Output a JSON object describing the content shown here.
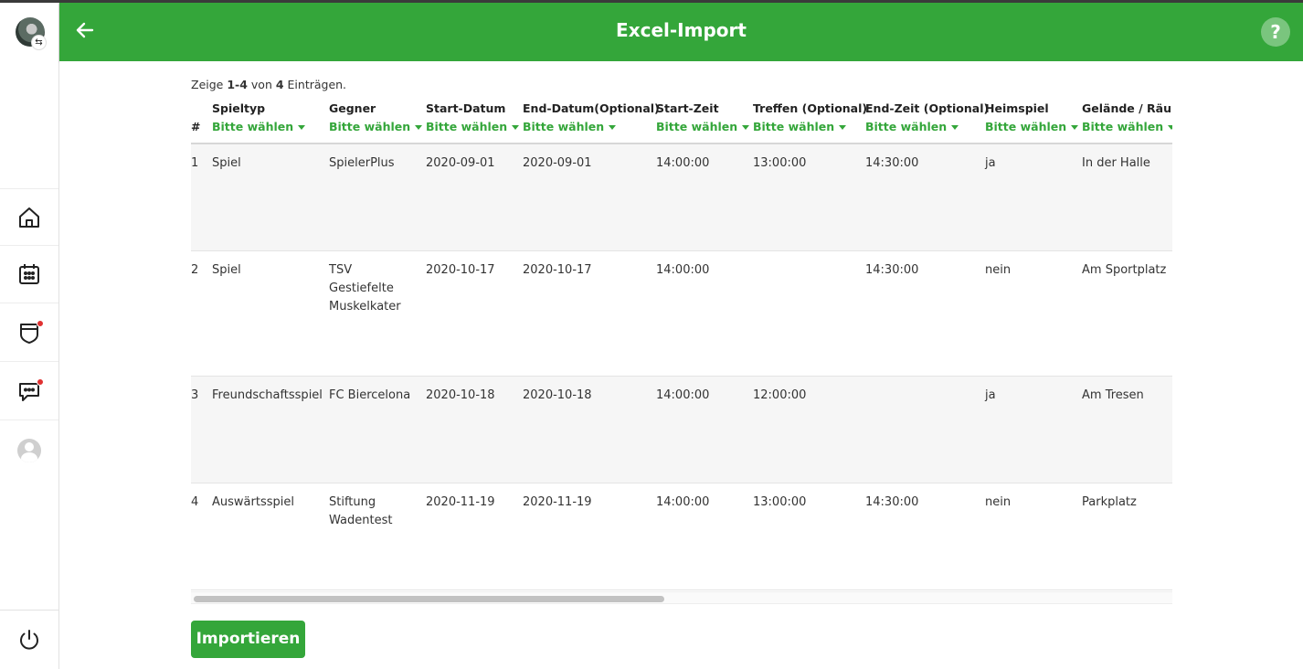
{
  "header": {
    "title": "Excel-Import",
    "help_label": "?"
  },
  "sidebar": {
    "swap_badge": "⇆",
    "items": [
      {
        "name": "home-icon"
      },
      {
        "name": "calendar-icon"
      },
      {
        "name": "shield-icon",
        "badge": true
      },
      {
        "name": "chat-icon",
        "badge": true
      },
      {
        "name": "profile-avatar"
      }
    ],
    "logout_icon": "power-icon"
  },
  "summary": {
    "prefix": "Zeige ",
    "range": "1-4",
    "middle": " von ",
    "total": "4",
    "suffix": " Einträgen."
  },
  "table": {
    "index_header": "#",
    "select_label": "Bitte wählen",
    "columns": [
      {
        "title": "Spieltyp"
      },
      {
        "title": "Gegner"
      },
      {
        "title": "Start-Datum"
      },
      {
        "title": "End-Datum(Optional)"
      },
      {
        "title": "Start-Zeit"
      },
      {
        "title": "Treffen (Optional)"
      },
      {
        "title": "End-Zeit (Optional)"
      },
      {
        "title": "Heimspiel"
      },
      {
        "title": "Gelände / Räumlichkeit"
      }
    ],
    "rows": [
      {
        "idx": "1",
        "cells": [
          "Spiel",
          "SpielerPlus",
          "2020-09-01",
          "2020-09-01",
          "14:00:00",
          "13:00:00",
          "14:30:00",
          "ja",
          "In der Halle"
        ]
      },
      {
        "idx": "2",
        "cells": [
          "Spiel",
          "TSV Gestiefelte Muskelkater",
          "2020-10-17",
          "2020-10-17",
          "14:00:00",
          "",
          "14:30:00",
          "nein",
          "Am Sportplatz"
        ]
      },
      {
        "idx": "3",
        "cells": [
          "Freundschaftsspiel",
          "FC Biercelona",
          "2020-10-18",
          "2020-10-18",
          "14:00:00",
          "12:00:00",
          "",
          "ja",
          "Am Tresen"
        ]
      },
      {
        "idx": "4",
        "cells": [
          "Auswärtsspiel",
          "Stiftung Wadentest",
          "2020-11-19",
          "2020-11-19",
          "14:00:00",
          "13:00:00",
          "14:30:00",
          "nein",
          "Parkplatz"
        ]
      }
    ]
  },
  "import_button": "Importieren",
  "colors": {
    "brand_green": "#34a63a",
    "badge_red": "#e03131"
  }
}
